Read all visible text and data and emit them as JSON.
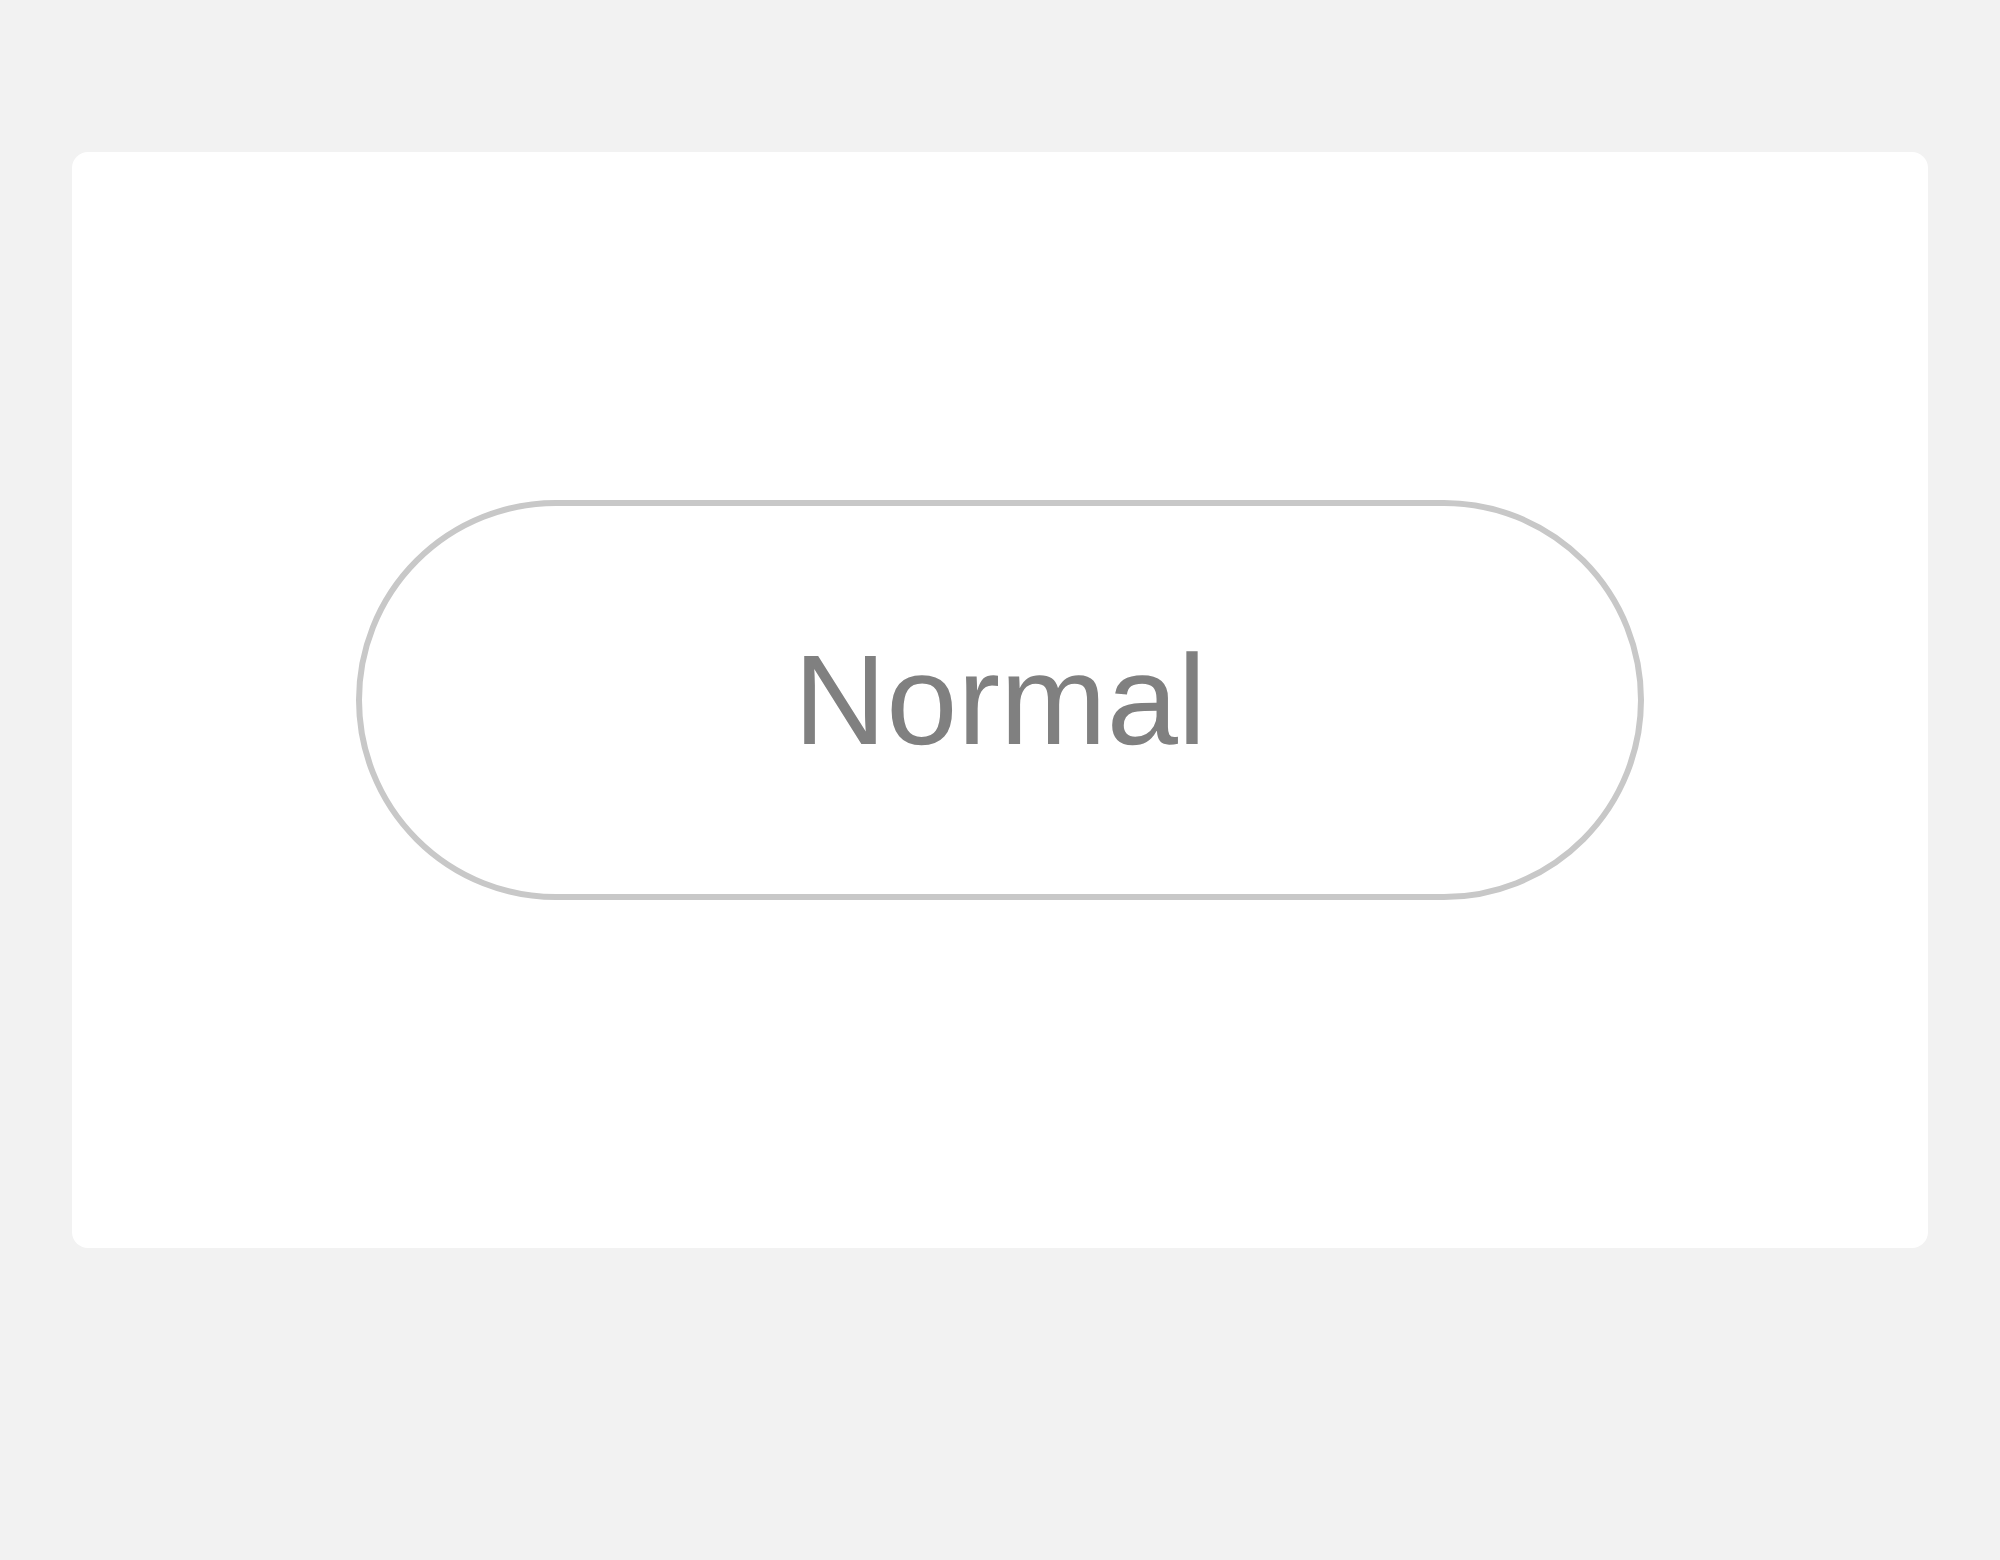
{
  "card": {
    "button": {
      "label": "Normal"
    }
  }
}
